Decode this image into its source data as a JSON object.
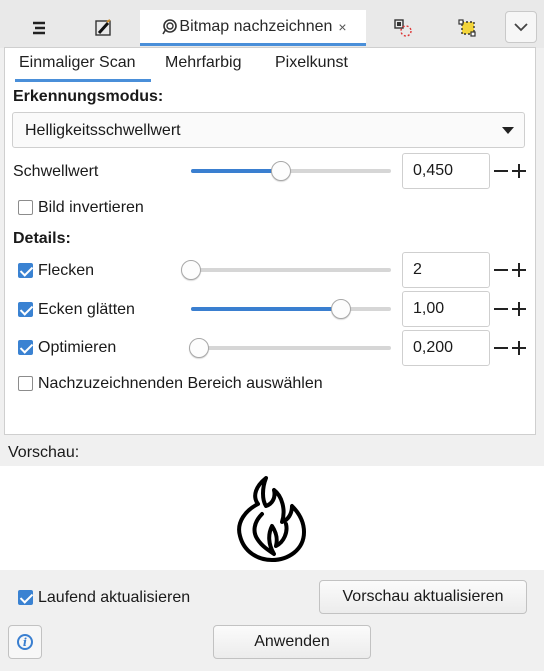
{
  "dock": {
    "tabs": [
      {
        "name": "objects-tab",
        "icon": "layers-icon"
      },
      {
        "name": "pen-tab",
        "icon": "pen-icon"
      },
      {
        "name": "trace-bitmap-tab",
        "icon": "trace-bitmap-icon",
        "title": "Bitmap nachzeichnen",
        "close": "×",
        "active": true
      },
      {
        "name": "transform-tab",
        "icon": "transform-icon"
      },
      {
        "name": "align-tab",
        "icon": "align-icon"
      }
    ],
    "menu_icon": "chevron-down-icon"
  },
  "subtabs": [
    "Einmaliger Scan",
    "Mehrfarbig",
    "Pixelkunst"
  ],
  "detection": {
    "label": "Erkennungsmodus:",
    "mode": "Helligkeitsschwellwert"
  },
  "threshold": {
    "label": "Schwellwert",
    "value": "0,450",
    "slider_fraction": 0.45
  },
  "invert": {
    "label": "Bild invertieren",
    "checked": false
  },
  "details": {
    "label": "Details:",
    "speckles": {
      "label": "Flecken",
      "checked": true,
      "value": "2",
      "slider_fraction": 0.0
    },
    "smooth_corners": {
      "label": "Ecken glätten",
      "checked": true,
      "value": "1,00",
      "slider_fraction": 0.75
    },
    "optimize": {
      "label": "Optimieren",
      "checked": true,
      "value": "0,200",
      "slider_fraction": 0.04
    }
  },
  "select_area": {
    "label": "Nachzuzeichnenden Bereich auswählen",
    "checked": false
  },
  "preview": {
    "label": "Vorschau:",
    "image_icon": "flame-outline-icon"
  },
  "live_update": {
    "label": "Laufend aktualisieren",
    "checked": true
  },
  "buttons": {
    "update_preview": "Vorschau aktualisieren",
    "apply": "Anwenden"
  },
  "colors": {
    "accent": "#3a7fd0",
    "tab_underline": "#4a8fd9"
  }
}
